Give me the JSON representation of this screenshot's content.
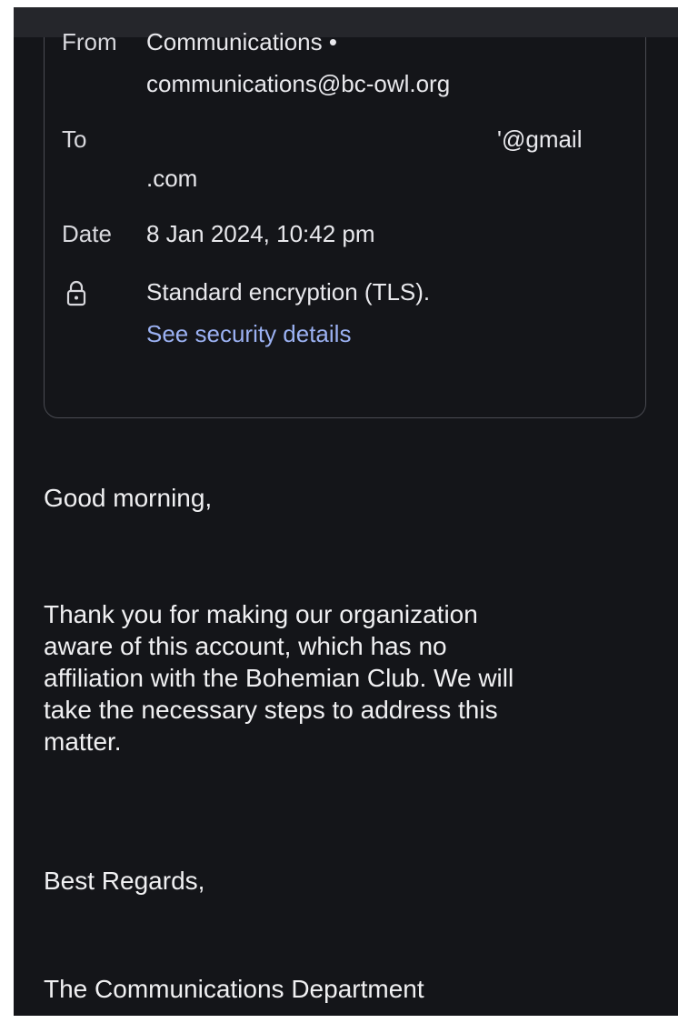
{
  "header": {
    "from_label": "From",
    "from_name": "Communications •",
    "from_email": "communications@bc-owl.org",
    "to_label": "To",
    "to_value_part1": "'@gmail",
    "to_value_part2": ".com",
    "date_label": "Date",
    "date_value": "8 Jan 2024, 10:42 pm",
    "encryption_text": "Standard encryption (TLS).",
    "security_link": "See security details",
    "lock_icon": "lock-icon"
  },
  "message": {
    "greeting": "Good morning,",
    "paragraph_lines": [
      "Thank you for making our organization",
      "aware of this account, which has no",
      "affiliation with the Bohemian Club. We will",
      "take the necessary steps to address this",
      "matter."
    ],
    "closing": "Best Regards,",
    "signature": "The Communications Department"
  },
  "colors": {
    "background": "#141519",
    "text": "#e6e6ea",
    "link": "#9bb1f2",
    "card_border": "#4a4b52"
  }
}
